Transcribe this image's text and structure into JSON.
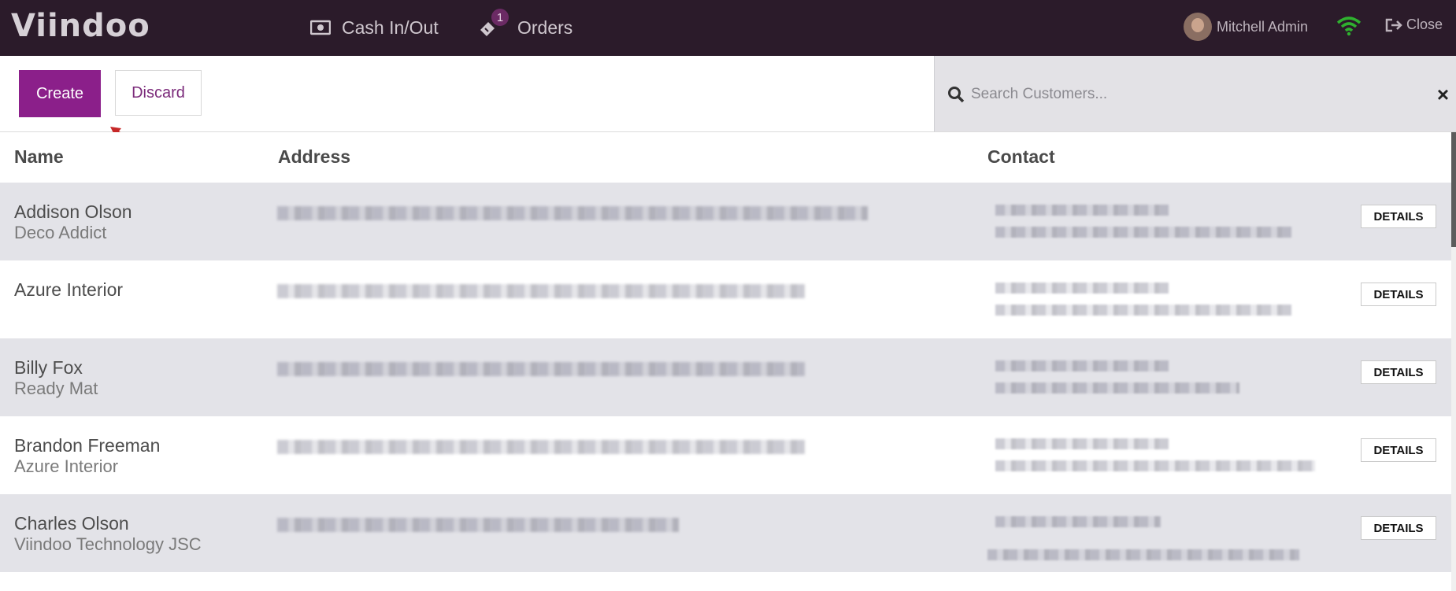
{
  "header": {
    "logo": "Viindoo",
    "cash_label": "Cash In/Out",
    "orders_label": "Orders",
    "orders_badge": "1",
    "user_name": "Mitchell Admin",
    "close_label": "Close"
  },
  "actions": {
    "create_label": "Create",
    "discard_label": "Discard"
  },
  "search": {
    "placeholder": "Search Customers...",
    "clear_icon": "×"
  },
  "table": {
    "headers": {
      "name": "Name",
      "address": "Address",
      "contact": "Contact"
    },
    "details_label": "DETAILS",
    "rows": [
      {
        "name": "Addison Olson",
        "company": "Deco Addict"
      },
      {
        "name": "Azure Interior",
        "company": ""
      },
      {
        "name": "Billy Fox",
        "company": "Ready Mat"
      },
      {
        "name": "Brandon Freeman",
        "company": "Azure Interior"
      },
      {
        "name": "Charles Olson",
        "company": "Viindoo Technology JSC"
      }
    ]
  },
  "colors": {
    "topbar": "#2b1b2a",
    "accent": "#8b1f8a",
    "row_alt": "#e3e3e8",
    "wifi": "#2fb12f"
  }
}
